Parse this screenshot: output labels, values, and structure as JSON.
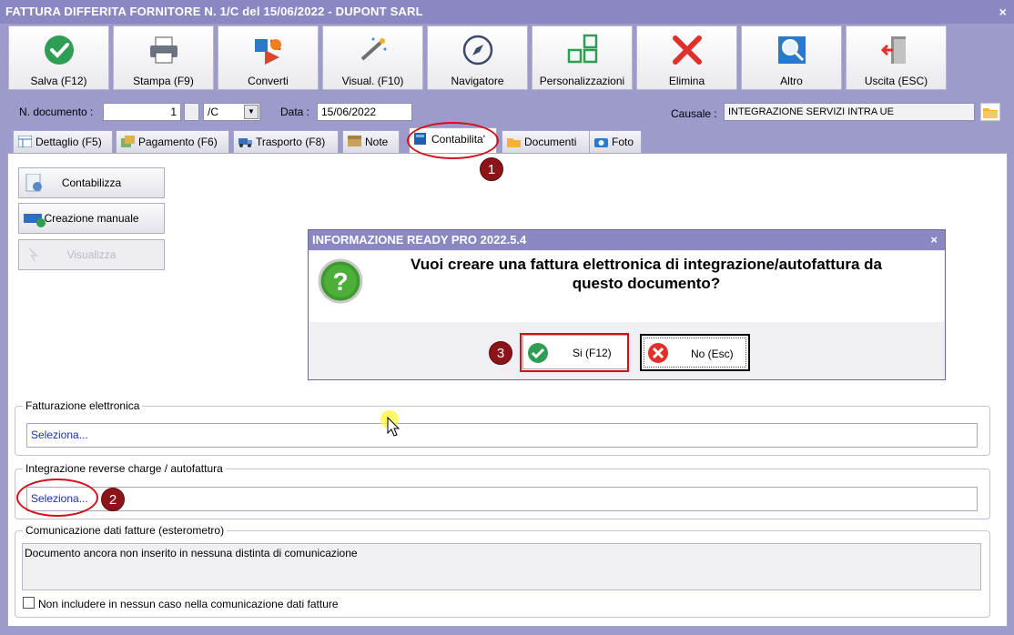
{
  "window": {
    "title": "FATTURA DIFFERITA FORNITORE N. 1/C del 15/06/2022 - DUPONT SARL",
    "close": "×"
  },
  "toolbar": [
    {
      "label": "Salva (F12)",
      "icon": "check-circle-icon"
    },
    {
      "label": "Stampa (F9)",
      "icon": "printer-icon"
    },
    {
      "label": "Converti",
      "icon": "convert-icon"
    },
    {
      "label": "Visual. (F10)",
      "icon": "magic-wand-icon"
    },
    {
      "label": "Navigatore",
      "icon": "compass-icon"
    },
    {
      "label": "Personalizzazioni",
      "icon": "grid-icon"
    },
    {
      "label": "Elimina",
      "icon": "red-x-icon"
    },
    {
      "label": "Altro",
      "icon": "magnifier-icon"
    },
    {
      "label": "Uscita (ESC)",
      "icon": "exit-door-icon"
    }
  ],
  "header": {
    "doc_number_label": "N. documento :",
    "doc_number_value": "1",
    "doc_suffix_value": "/C",
    "date_label": "Data :",
    "date_value": "15/06/2022",
    "causale_label": "Causale :",
    "causale_value": "INTEGRAZIONE SERVIZI INTRA UE"
  },
  "tabs": [
    {
      "label": "Dettaglio (F5)",
      "icon": "table-icon"
    },
    {
      "label": "Pagamento (F6)",
      "icon": "coins-icon"
    },
    {
      "label": "Trasporto (F8)",
      "icon": "truck-icon"
    },
    {
      "label": "Note",
      "icon": "note-icon"
    },
    {
      "label": "Contabilita'",
      "icon": "ledger-icon",
      "active": true
    },
    {
      "label": "Documenti",
      "icon": "folder-icon"
    },
    {
      "label": "Foto",
      "icon": "camera-icon"
    }
  ],
  "actions": {
    "contabilizza": "Contabilizza",
    "creazione_manuale": "Creazione manuale",
    "visualizza": "Visualizza"
  },
  "groups": {
    "fatturazione_title": "Fatturazione elettronica",
    "fatturazione_value": "Seleziona...",
    "integrazione_title": "Integrazione reverse charge / autofattura",
    "integrazione_value": "Seleziona...",
    "comunicazione_title": "Comunicazione dati fatture (esterometro)",
    "comunicazione_text": "Documento ancora non inserito in nessuna distinta di comunicazione",
    "checkbox_label": "Non includere in nessun caso nella comunicazione dati fatture"
  },
  "dialog": {
    "title": "INFORMAZIONE READY PRO 2022.5.4",
    "close": "×",
    "message_line1": "Vuoi creare una fattura elettronica di integrazione/autofattura da",
    "message_line2": "questo documento?",
    "yes_label": "Si (F12)",
    "no_label": "No (Esc)"
  },
  "annotations": {
    "badge1": "1",
    "badge2": "2",
    "badge3": "3"
  },
  "colors": {
    "title_bar": "#8a87c2",
    "window_bg": "#9d9bcb",
    "annotation_red": "#d0121b",
    "badge": "#8c1318",
    "link_blue": "#1a2fb3"
  }
}
